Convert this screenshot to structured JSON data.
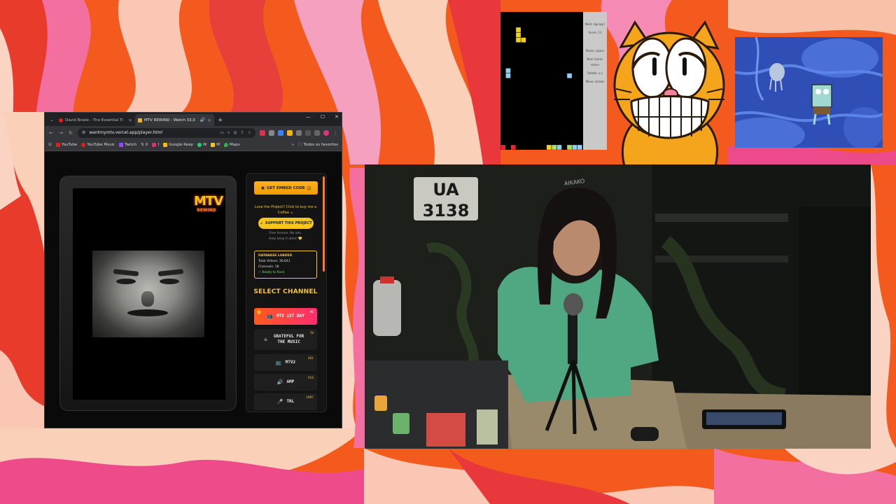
{
  "browser": {
    "tabs": [
      {
        "title": "David Bowie - The Essential Ti",
        "favicon_color": "#e02020",
        "active": false
      },
      {
        "title": "MTV REWIND - Watch 33,0",
        "favicon_color": "#f2b418",
        "active": true
      }
    ],
    "new_tab": "+",
    "url": "wantmymtv.vercel.app/player.html",
    "bookmarks": [
      {
        "label": "YouTube",
        "color": "#e02020"
      },
      {
        "label": "YouTube Music",
        "color": "#e02020"
      },
      {
        "label": "Twitch",
        "color": "#9146ff"
      },
      {
        "label": "X",
        "color": "#dddddd"
      },
      {
        "label": "I",
        "color": "#e1306c"
      },
      {
        "label": "Google Keep",
        "color": "#fbbc04"
      },
      {
        "label": "W",
        "color": "#25d366"
      },
      {
        "label": "M",
        "color": "#f5c518"
      },
      {
        "label": "Maps",
        "color": "#34a853"
      }
    ],
    "bookmarks_more": "»",
    "all_bookmarks": "Todos os favoritos"
  },
  "player": {
    "logo_top": "MTV",
    "logo_bottom": "REWIND",
    "embed_label": "GET EMBED CODE",
    "love_text": "Love the Project? Click to buy me a Coffee ☕",
    "support_label": "SUPPORT THIS PROJECT",
    "free_text_1": "Free forever. No ads.",
    "free_text_2": "Help keep it alive! 💛",
    "status_title": "DATABASE LOADED",
    "status_videos": "Total Videos: 36,641",
    "status_channels": "Channels: 18",
    "status_ready": "✓ Ready to Rock",
    "select_channel": "SELECT CHANNEL",
    "channels": [
      {
        "label": "MTV 1ST DAY",
        "num": "96",
        "icon": "📺",
        "active": true
      },
      {
        "label": "GRATEFUL FOR THE MUSIC",
        "num": "78",
        "icon": "☠",
        "active": false
      },
      {
        "label": "MTV2",
        "num": "461",
        "icon": "📺",
        "active": false
      },
      {
        "label": "AMP",
        "num": "554",
        "icon": "🔊",
        "active": false
      },
      {
        "label": "TRL",
        "num": "1997",
        "icon": "🎤",
        "active": false
      }
    ]
  },
  "tetris": {
    "next_label": "Next: zig-zag l",
    "score_label": "Score: 11",
    "pause_label": "Pause: space",
    "newgame_label": "New Game: return",
    "rotate_label": "Rotate: x,z",
    "move_label": "Move: arrows"
  },
  "webcam": {
    "plate_line1": "UA",
    "plate_line2": "3138",
    "headphone_text": "AIKAKO"
  }
}
